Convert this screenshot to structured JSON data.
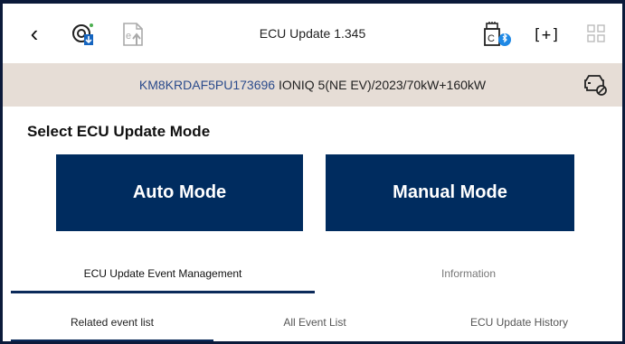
{
  "header": {
    "title": "ECU Update 1.345",
    "icons": [
      "back-icon",
      "ecu-sync-icon",
      "epub-upload-icon",
      "bluetooth-vci-icon",
      "screen-capture-icon",
      "grid-menu-icon"
    ],
    "capture_label": "[+]"
  },
  "vehicle": {
    "vin": "KM8KRDAF5PU173696",
    "model": "IONIQ 5(NE EV)/2023/70kW+160kW"
  },
  "main": {
    "section_title": "Select ECU Update Mode",
    "auto_mode_label": "Auto Mode",
    "manual_mode_label": "Manual Mode"
  },
  "tabs_primary": [
    {
      "label": "ECU Update Event Management",
      "active": true
    },
    {
      "label": "Information",
      "active": false
    }
  ],
  "tabs_secondary": [
    {
      "label": "Related event list",
      "active": true
    },
    {
      "label": "All Event List",
      "active": false
    },
    {
      "label": "ECU Update History",
      "active": false
    }
  ],
  "colors": {
    "primary_button": "#002c5f",
    "vin_bar": "#e6ddd6",
    "vin_text": "#2b4b8c",
    "active_indicator": "#0b2a5a",
    "ecu_icon_accent": "#1565c0",
    "bluetooth_accent": "#1e88e5",
    "status_dot": "#4caf50"
  }
}
